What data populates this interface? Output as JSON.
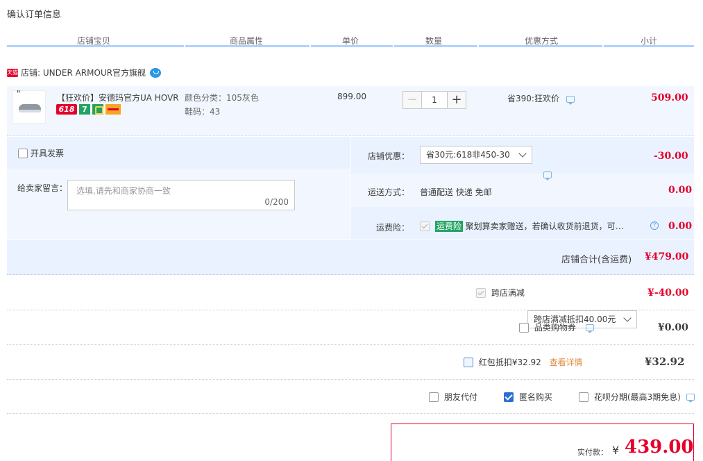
{
  "page": {
    "title": "确认订单信息"
  },
  "table_header": [
    "店铺宝贝",
    "商品属性",
    "单价",
    "数量",
    "优惠方式",
    "小计"
  ],
  "shop": {
    "badge": "天猫",
    "label": "店铺: UNDER ARMOUR官方旗舰"
  },
  "item": {
    "quote_mark": "\"",
    "title": "【狂欢价】安德玛官方UA HOVR Phantom",
    "badge_618": "618",
    "badge_7": "7",
    "attr_color": "颜色分类：105灰色",
    "attr_size": "鞋码：43",
    "unit_price": "899.00",
    "quantity": "1",
    "qty_minus": "−",
    "qty_plus": "+",
    "discount": "省390:狂欢价",
    "subtotal": "509.00"
  },
  "order_options": {
    "invoice_label": "开具发票",
    "note_label": "给卖家留言：",
    "note_placeholder": "选填,请先和商家协商一致",
    "note_count": "0/200"
  },
  "shop_discount": {
    "label": "店铺优惠：",
    "selected": "省30元:618非450-30",
    "value": "-30.00"
  },
  "shipping": {
    "label": "运送方式：",
    "method": "普通配送 快递 免邮",
    "value": "0.00"
  },
  "insurance": {
    "label": "运费险：",
    "badge": "运费险",
    "text": "聚划算卖家赠送，若确认收货前退货，可获保险赔付",
    "value": "0.00"
  },
  "shop_total": {
    "label": "店铺合计(含运费)",
    "value": "¥479.00"
  },
  "cross_shop": {
    "label": "跨店满减",
    "selected": "跨店满减抵扣40.00元",
    "value": "¥-40.00"
  },
  "category_coupon": {
    "label": "品类购物券",
    "value": "¥0.00"
  },
  "red_packet": {
    "label": "红包抵扣¥32.92",
    "link": "查看详情",
    "value": "¥32.92"
  },
  "bottom_options": {
    "friend_pay": "朋友代付",
    "anonymous": "匿名购买",
    "huabei": "花呗分期(最高3期免息)"
  },
  "payment": {
    "label": "实付款：",
    "currency": "¥",
    "value": "439.00"
  },
  "colors": {
    "accent_red": "#e4002b",
    "header_line": "#b2d1ff",
    "panel_bg": "#eaf2ff",
    "check_blue": "#2a6fd6",
    "insurance_green": "#21a463"
  }
}
